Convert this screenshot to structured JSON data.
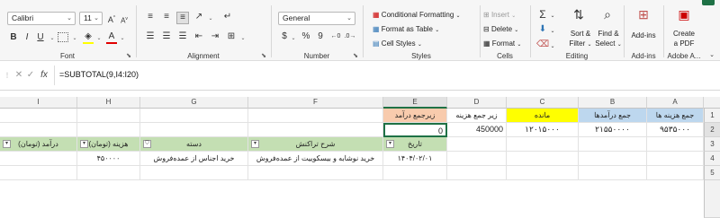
{
  "ribbon": {
    "font": {
      "name": "Calibri",
      "size": "11",
      "group_label": "Font"
    },
    "alignment": {
      "group_label": "Alignment"
    },
    "number": {
      "format": "General",
      "group_label": "Number",
      "currency": "$",
      "percent": "%",
      "comma": "9"
    },
    "styles": {
      "conditional_formatting": "Conditional Formatting",
      "format_as_table": "Format as Table",
      "cell_styles": "Cell Styles",
      "group_label": "Styles"
    },
    "cells": {
      "insert": "Insert",
      "delete": "Delete",
      "format": "Format",
      "group_label": "Cells"
    },
    "editing": {
      "sort_filter_1": "Sort &",
      "sort_filter_2": "Filter",
      "find_select_1": "Find &",
      "find_select_2": "Select",
      "group_label": "Editing"
    },
    "addins": {
      "label": "Add-ins",
      "group_label": "Add-ins"
    },
    "adobe": {
      "label1": "Create",
      "label2": "a PDF",
      "group_label": "Adobe A..."
    }
  },
  "formula_bar": {
    "formula": "=SUBTOTAL(9,I4:I20)",
    "fx": "fx"
  },
  "columns": [
    "A",
    "B",
    "C",
    "D",
    "E",
    "F",
    "G",
    "H",
    "I"
  ],
  "rows": [
    "1",
    "2",
    "3",
    "4",
    "5"
  ],
  "summary": {
    "headers": [
      "جمع هزینه ها",
      "جمع درآمدها",
      "مانده",
      "زیر جمع هزینه",
      "زیرجمع درآمد"
    ],
    "values": [
      "۹۵۳۵۰۰۰",
      "۲۱۵۵۰۰۰۰",
      "۱۲۰۱۵۰۰۰",
      "450000",
      "0"
    ]
  },
  "table": {
    "headers": [
      "تاریخ",
      "شرح تراکنش",
      "دسته",
      "هزینه (تومان)",
      "درآمد (تومان)"
    ],
    "row": [
      "۱۴۰۴/۰۲/۰۱",
      "خرید نوشابه و بیسکوییت از عمده‌فروش",
      "خرید اجناس از عمده‌فروش",
      "۴۵۰۰۰۰",
      ""
    ]
  },
  "colors": {
    "header_green": "#c4dfb3",
    "header_blue": "#bdd7ee",
    "header_yellow": "#ffff00",
    "header_orange": "#f8cbad",
    "excel_green": "#1e7145"
  }
}
